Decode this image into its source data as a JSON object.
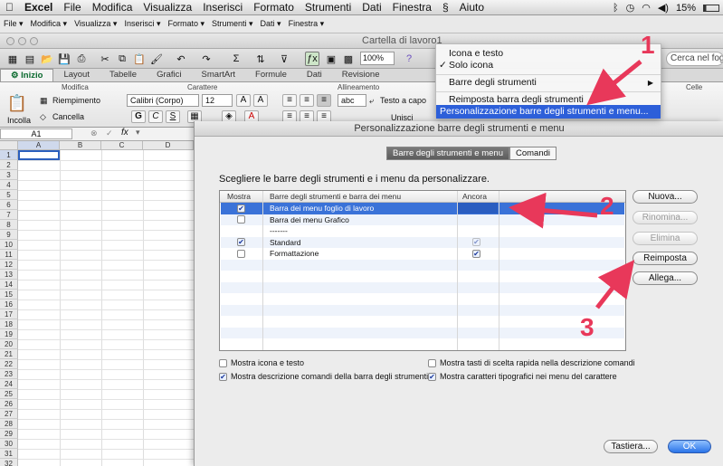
{
  "menubar": {
    "apple": "",
    "items": [
      "Excel",
      "File",
      "Modifica",
      "Visualizza",
      "Inserisci",
      "Formato",
      "Strumenti",
      "Dati",
      "Finestra",
      "Aiuto"
    ],
    "battery": "15%"
  },
  "row2": [
    "File ▾",
    "Modifica ▾",
    "Visualizza ▾",
    "Inserisci ▾",
    "Formato ▾",
    "Strumenti ▾",
    "Dati ▾",
    "Finestra ▾"
  ],
  "window": {
    "title": "Cartella di lavoro1"
  },
  "toolbar": {
    "zoom": "100%",
    "search_placeholder": "Cerca nel foglio"
  },
  "tabs": [
    "Inizio",
    "Layout",
    "Tabelle",
    "Grafici",
    "SmartArt",
    "Formule",
    "Dati",
    "Revisione"
  ],
  "ribbon": {
    "group_modifica": "Modifica",
    "group_carattere": "Carattere",
    "group_allineamento": "Allineamento",
    "group_celle": "Celle",
    "incolla": "Incolla",
    "riempimento": "Riempimento",
    "cancella": "Cancella",
    "font": "Calibri (Corpo)",
    "size": "12",
    "testo_a_capo": "Testo a capo",
    "unisci": "Unisci",
    "abc": "abc",
    "bold": "G",
    "italic": "C",
    "underline": "S"
  },
  "formulabar": {
    "cell": "A1",
    "fx": "fx"
  },
  "sheet": {
    "columns": [
      "A",
      "B",
      "C",
      "D"
    ],
    "rows": [
      "1",
      "2",
      "3",
      "4",
      "5",
      "6",
      "7",
      "8",
      "9",
      "10",
      "11",
      "12",
      "13",
      "14",
      "15",
      "16",
      "17",
      "18",
      "19",
      "20",
      "21",
      "22",
      "23",
      "24",
      "25",
      "26",
      "27",
      "28",
      "29",
      "30",
      "31",
      "32",
      "33"
    ]
  },
  "context_menu": {
    "items": [
      "Icona e testo",
      "Solo icona",
      "Barre degli strumenti",
      "Reimposta barra degli strumenti",
      "Personalizzazione barre degli strumenti e menu..."
    ],
    "checked": "✓",
    "submenu_arrow": "▶"
  },
  "dialog": {
    "title": "Personalizzazione barre degli strumenti e menu",
    "tabs": [
      "Barre degli strumenti e menu",
      "Comandi"
    ],
    "intro": "Scegliere le barre degli strumenti e i menu da personalizzare.",
    "columns": [
      "Mostra",
      "Barre degli strumenti e barra dei menu",
      "Ancora"
    ],
    "rows": [
      {
        "mostra": true,
        "name": "Barra dei menu foglio di lavoro",
        "ancora": null
      },
      {
        "mostra": false,
        "name": "Barra dei menu Grafico",
        "ancora": null
      },
      {
        "mostra": null,
        "name": "-------",
        "ancora": null
      },
      {
        "mostra": true,
        "name": "Standard",
        "ancora": true
      },
      {
        "mostra": false,
        "name": "Formattazione",
        "ancora": true
      }
    ],
    "buttons": {
      "nuova": "Nuova...",
      "rinomina": "Rinomina...",
      "elimina": "Elimina",
      "reimposta": "Reimposta",
      "allega": "Allega...",
      "tastiera": "Tastiera...",
      "ok": "OK"
    },
    "options": [
      {
        "label": "Mostra icona e testo",
        "checked": false
      },
      {
        "label": "Mostra tasti di scelta rapida nella descrizione comandi",
        "checked": false
      },
      {
        "label": "Mostra descrizione comandi della barra degli strumenti",
        "checked": true
      },
      {
        "label": "Mostra caratteri tipografici nei menu del carattere",
        "checked": true
      }
    ],
    "check": "✔"
  },
  "annotations": [
    "1",
    "2",
    "3"
  ],
  "colors": {
    "arrow": "#e8385a",
    "selection": "#3a72d8",
    "menu_highlight": "#2d5fd9",
    "active_tab_text": "#0a6a2e"
  }
}
